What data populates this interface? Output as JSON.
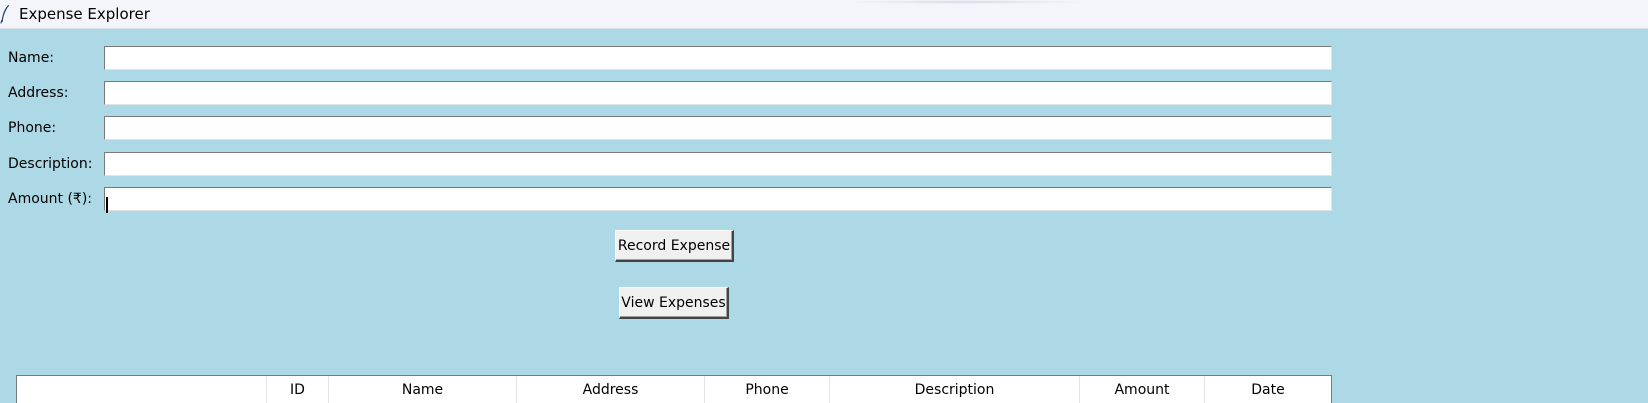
{
  "window": {
    "title": "Expense Explorer",
    "icon": "feather-icon"
  },
  "form": {
    "name_label": "Name:",
    "address_label": "Address:",
    "phone_label": "Phone:",
    "description_label": "Description:",
    "amount_label": "Amount (₹):",
    "name_value": "",
    "address_value": "",
    "phone_value": "",
    "description_value": "",
    "amount_value": ""
  },
  "buttons": {
    "record_label": "Record Expense",
    "view_label": "View Expenses"
  },
  "table": {
    "columns": [
      "",
      "ID",
      "Name",
      "Address",
      "Phone",
      "Description",
      "Amount",
      "Date"
    ],
    "rows": []
  },
  "colors": {
    "background": "#add8e6",
    "titlebar": "#f3f5fa",
    "field": "#ffffff",
    "button": "#f0f0f0"
  }
}
